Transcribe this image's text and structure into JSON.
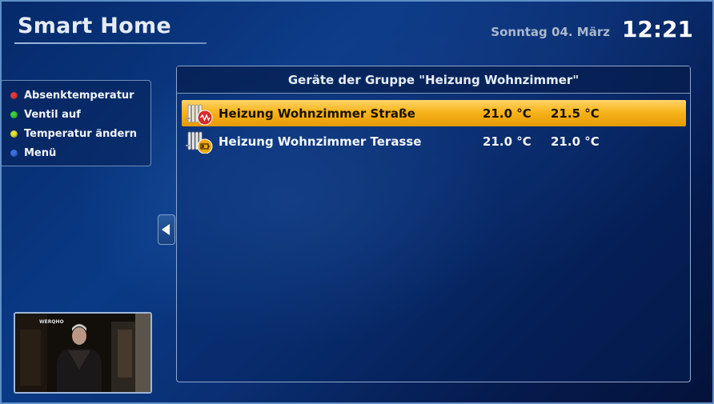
{
  "header": {
    "app_title": "Smart Home",
    "date": "Sonntag 04. März",
    "time": "12:21"
  },
  "legend": {
    "items": [
      {
        "label": "Absenktemperatur",
        "color": "#e23b3b",
        "icon": "red-key-dot"
      },
      {
        "label": "Ventil auf",
        "color": "#3ccf3c",
        "icon": "green-key-dot"
      },
      {
        "label": "Temperatur ändern",
        "color": "#e6e23a",
        "icon": "yellow-key-dot"
      },
      {
        "label": "Menü",
        "color": "#3b6fe6",
        "icon": "blue-key-dot"
      }
    ]
  },
  "panel": {
    "title": "Geräte der Gruppe \"Heizung Wohnzimmer\"",
    "devices": [
      {
        "name": "Heizung Wohnzimmer Straße",
        "current_temp": "21.0 °C",
        "target_temp": "21.5 °C",
        "selected": true,
        "icon": "radiator-icon",
        "badge": "error-badge"
      },
      {
        "name": "Heizung Wohnzimmer Terasse",
        "current_temp": "21.0 °C",
        "target_temp": "21.0 °C",
        "selected": false,
        "icon": "radiator-icon",
        "badge": "battery-badge"
      }
    ]
  },
  "nav": {
    "back_icon": "chevron-left-icon"
  },
  "video": {
    "caption": "WERQHO"
  },
  "colors": {
    "selected_row": "#f7b41c",
    "background": "#0a3a86",
    "badge_error": "#d42a2a",
    "badge_battery": "#f2a80c"
  }
}
